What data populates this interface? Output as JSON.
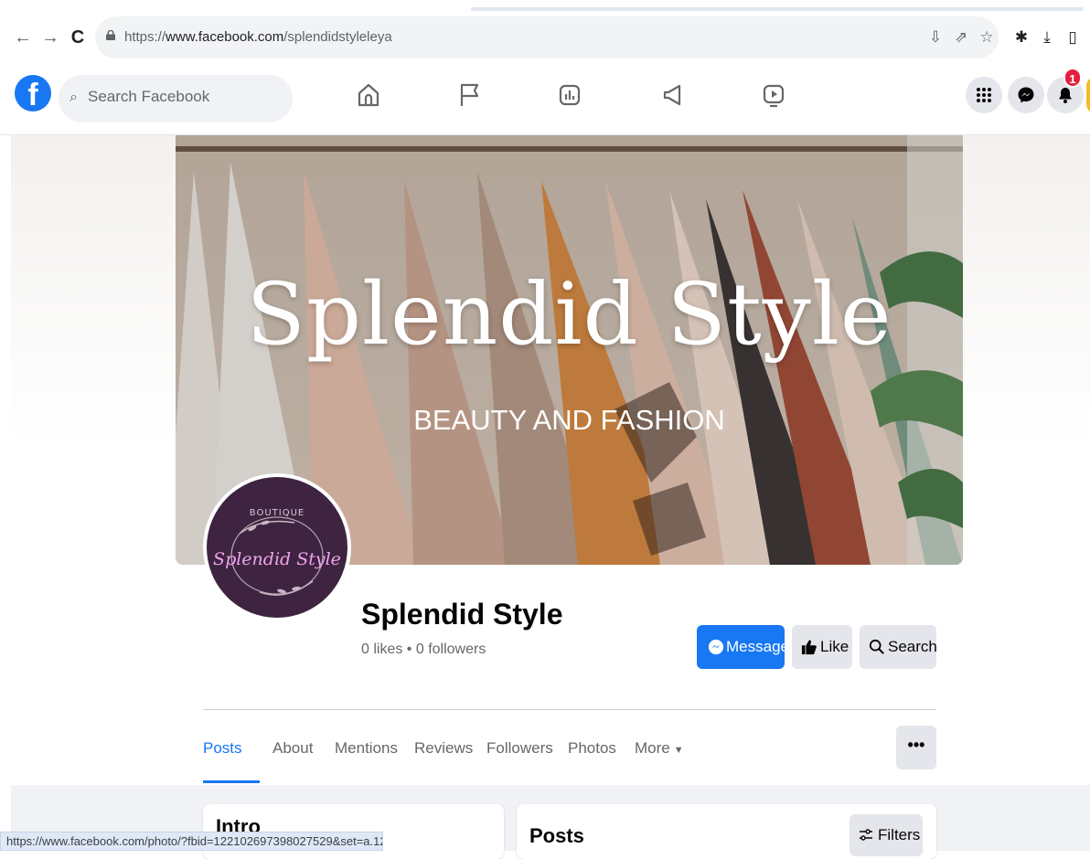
{
  "browser": {
    "url_scheme": "https://",
    "url_host": "www.facebook.com",
    "url_path": "/splendidstyleleya",
    "status_url": "https://www.facebook.com/photo/?fbid=122102697398027529&set=a.12210306..."
  },
  "fb_nav": {
    "search_placeholder": "Search Facebook",
    "notification_count": "1"
  },
  "cover": {
    "title": "Splendid Style",
    "subtitle": "BEAUTY AND FASHION"
  },
  "profile_logo": {
    "top_text": "BOUTIQUE",
    "script_text": "Splendid Style"
  },
  "page": {
    "name": "Splendid Style",
    "stats": "0 likes • 0 followers"
  },
  "actions": {
    "message": "Message",
    "like": "Like",
    "search": "Search"
  },
  "tabs": [
    {
      "label": "Posts"
    },
    {
      "label": "About"
    },
    {
      "label": "Mentions"
    },
    {
      "label": "Reviews"
    },
    {
      "label": "Followers"
    },
    {
      "label": "Photos"
    },
    {
      "label": "More"
    }
  ],
  "more_menu_label": "•••",
  "sections": {
    "intro": "Intro",
    "posts": "Posts",
    "filters": "Filters"
  },
  "colors": {
    "brand": "#1877f2",
    "badge": "#e41e3f",
    "profile_bg": "#3e2440",
    "logo_neon": "#f0a6ee"
  }
}
